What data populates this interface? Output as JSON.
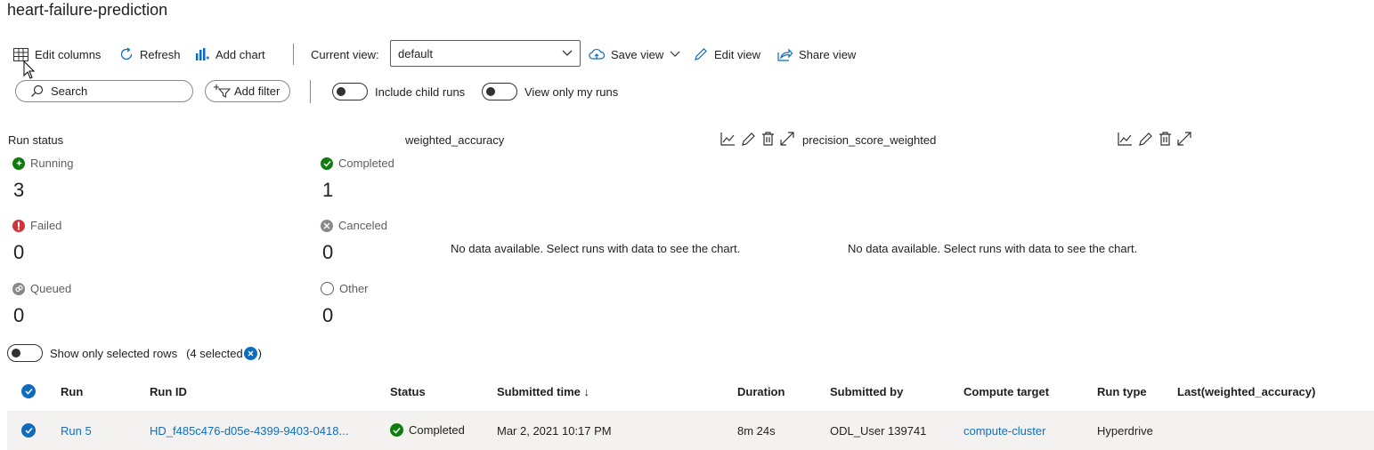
{
  "page": {
    "title": "heart-failure-prediction"
  },
  "toolbar": {
    "edit_columns": "Edit columns",
    "refresh": "Refresh",
    "add_chart": "Add chart",
    "current_view_label": "Current view:",
    "current_view_value": "default",
    "save_view": "Save view",
    "edit_view": "Edit view",
    "share_view": "Share view"
  },
  "filters": {
    "search_placeholder": "Search",
    "add_filter": "Add filter",
    "include_child_runs": "Include child runs",
    "view_only_my_runs": "View only my runs"
  },
  "run_status": {
    "heading": "Run status",
    "items": [
      {
        "label": "Running",
        "count": "3",
        "color": "#107c10"
      },
      {
        "label": "Completed",
        "count": "1",
        "color": "#107c10"
      },
      {
        "label": "Failed",
        "count": "0",
        "color": "#d13438"
      },
      {
        "label": "Canceled",
        "count": "0",
        "color": "#8a8886"
      },
      {
        "label": "Queued",
        "count": "0",
        "color": "#8a8886"
      },
      {
        "label": "Other",
        "count": "0",
        "color": "#8a8886"
      }
    ]
  },
  "charts": [
    {
      "title": "weighted_accuracy",
      "empty_message": "No data available. Select runs with data to see the chart."
    },
    {
      "title": "precision_score_weighted",
      "empty_message": "No data available. Select runs with data to see the chart."
    }
  ],
  "selection": {
    "show_only_selected": "Show only selected rows",
    "selected_count": "(4 selected",
    "close_paren": ")"
  },
  "table": {
    "columns": [
      "Run",
      "Run ID",
      "Status",
      "Submitted time ↓",
      "Duration",
      "Submitted by",
      "Compute target",
      "Run type",
      "Last(weighted_accuracy)"
    ],
    "rows": [
      {
        "run": "Run 5",
        "run_id": "HD_f485c476-d05e-4399-9403-0418...",
        "status": "Completed",
        "submitted_time": "Mar 2, 2021 10:17 PM",
        "duration": "8m 24s",
        "submitted_by": "ODL_User 139741",
        "compute_target": "compute-cluster",
        "run_type": "Hyperdrive",
        "last_weighted_accuracy": ""
      }
    ]
  }
}
